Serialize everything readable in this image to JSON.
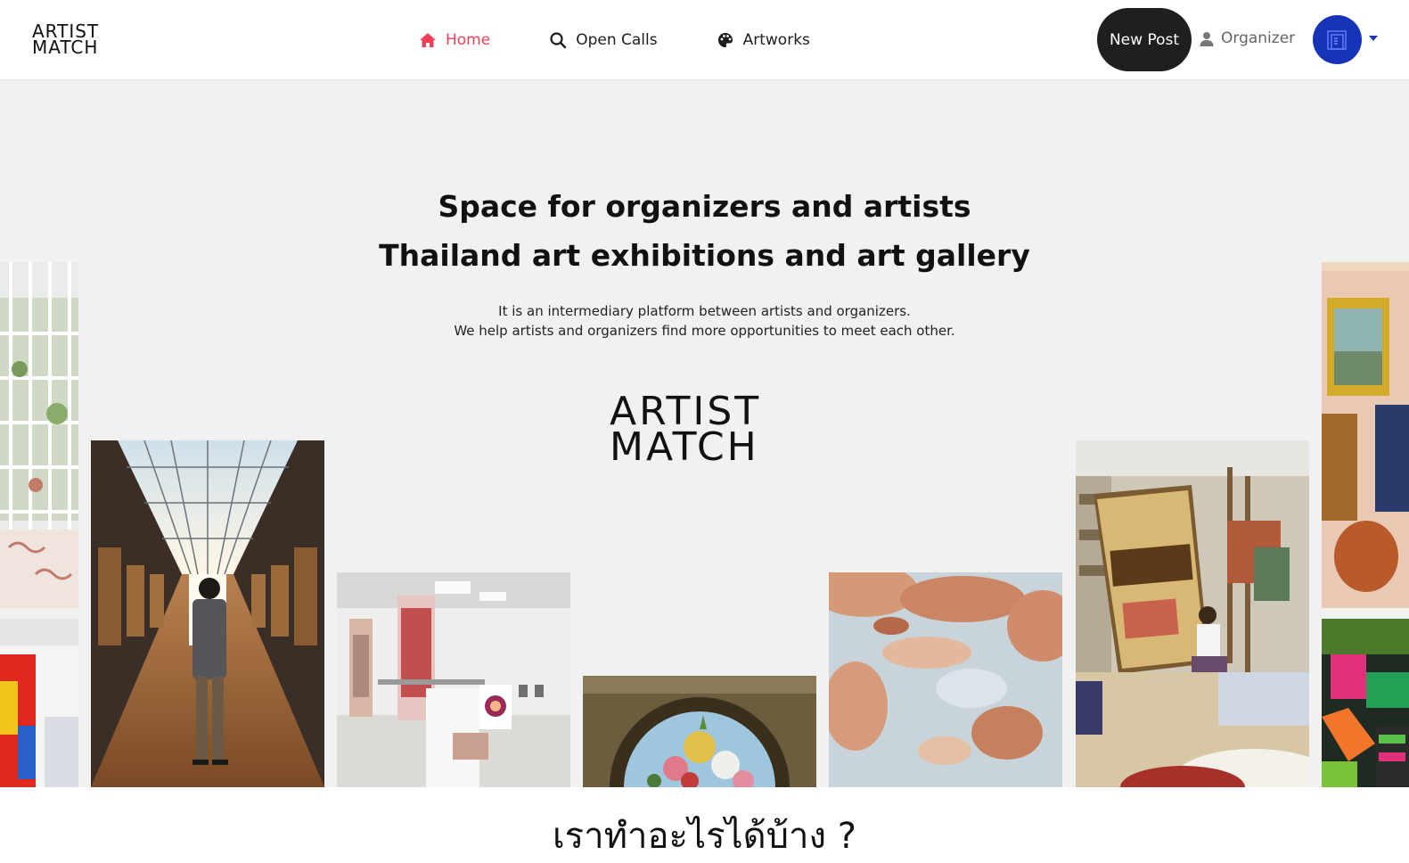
{
  "header": {
    "logo_line1": "ARTIST",
    "logo_line2": "MATCH",
    "nav": [
      {
        "label": "Home",
        "icon": "home-icon",
        "active": true
      },
      {
        "label": "Open Calls",
        "icon": "search-icon",
        "active": false
      },
      {
        "label": "Artworks",
        "icon": "palette-icon",
        "active": false
      }
    ],
    "new_post_label": "New Post",
    "role_label": "Organizer",
    "role_icon": "user-icon",
    "avatar_icon": "building-icon",
    "accent_color": "#ef3f5a",
    "avatar_color": "#1733b8"
  },
  "hero": {
    "title_line1": "Space for organizers and artists",
    "title_line2": "Thailand art exhibitions and art gallery",
    "subtitle_line1": "It is an intermediary platform between artists and organizers.",
    "subtitle_line2": "We help artists and organizers find more opportunities to meet each other.",
    "logo_line1": "ARTIST",
    "logo_line2": "MATCH",
    "images": [
      "gallery-window-image",
      "colorful-installation-image",
      "gallery-hall-visitor-image",
      "exhibition-hanging-prints-image",
      "floral-arch-painting-image",
      "ceiling-fresco-image",
      "artist-painting-studio-image",
      "interior-painting-image",
      "patterned-textile-image"
    ]
  },
  "section": {
    "heading": "เราทำอะไรได้บ้าง ?"
  }
}
